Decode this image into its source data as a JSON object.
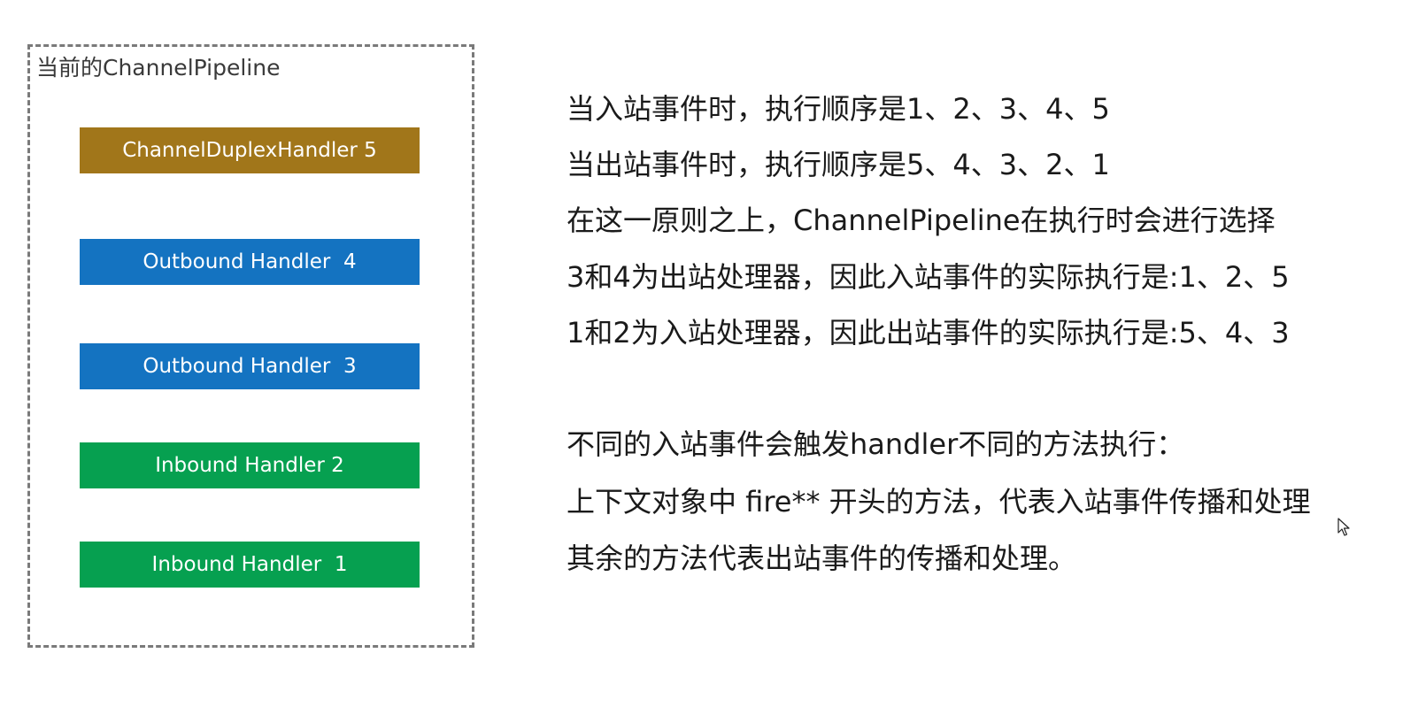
{
  "pipeline": {
    "title": "当前的ChannelPipeline",
    "handlers": [
      {
        "label": "ChannelDuplexHandler 5",
        "color": "#a1761a"
      },
      {
        "label": "Outbound Handler  4",
        "color": "#1473c1"
      },
      {
        "label": "Outbound Handler  3",
        "color": "#1473c1"
      },
      {
        "label": "Inbound Handler 2",
        "color": "#06a050"
      },
      {
        "label": "Inbound Handler  1",
        "color": "#06a050"
      }
    ]
  },
  "notes": {
    "lines": [
      "当入站事件时，执行顺序是1、2、3、4、5",
      "当出站事件时，执行顺序是5、4、3、2、1",
      "在这一原则之上，ChannelPipeline在执行时会进行选择",
      "3和4为出站处理器，因此入站事件的实际执行是:1、2、5",
      "1和2为入站处理器，因此出站事件的实际执行是:5、4、3",
      "不同的入站事件会触发handler不同的方法执行：",
      "上下文对象中 fire** 开头的方法，代表入站事件传播和处理",
      "其余的方法代表出站事件的传播和处理。"
    ]
  },
  "cursor": {
    "icon": "mouse-pointer-icon"
  }
}
